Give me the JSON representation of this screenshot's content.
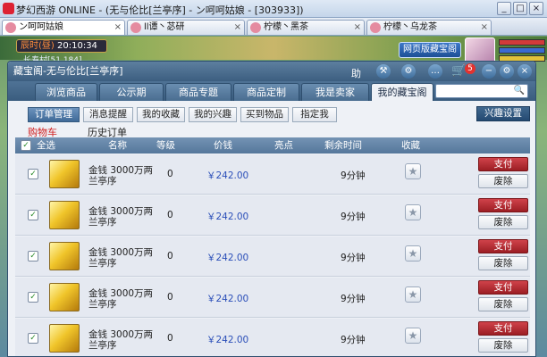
{
  "window": {
    "title": "梦幻西游 ONLINE - (无与伦比[兰亭序] - ン呵呵姑娘 - [303933])"
  },
  "browser_tabs": [
    {
      "label": "ン呵呵姑娘"
    },
    {
      "label": "ll谭丶苾研"
    },
    {
      "label": "柠檬丶黑茶"
    },
    {
      "label": "柠檬丶乌龙茶"
    }
  ],
  "game": {
    "time_label": "辰时(昼)",
    "time_value": "20:10:34",
    "location": "长寿村[51,184]",
    "web_button": "网页版藏宝阁"
  },
  "dialog": {
    "title": "藏宝阁-无与伦比[兰亭序]",
    "help_label": "助",
    "cart_count": "5",
    "nav_tabs": [
      {
        "label": "浏览商品"
      },
      {
        "label": "公示期"
      },
      {
        "label": "商品专题"
      },
      {
        "label": "商品定制"
      },
      {
        "label": "我是卖家"
      },
      {
        "label": "我的藏宝阁"
      }
    ],
    "sub_tabs": [
      {
        "label": "订单管理"
      },
      {
        "label": "消息提醒"
      },
      {
        "label": "我的收藏"
      },
      {
        "label": "我的兴趣"
      },
      {
        "label": "买到物品"
      },
      {
        "label": "指定我"
      }
    ],
    "settings_button": "兴趣设置",
    "cart_label": "购物车",
    "history_label": "历史订单",
    "table": {
      "headers": {
        "select_all": "全选",
        "name": "名称",
        "level": "等级",
        "price": "价钱",
        "highlight": "亮点",
        "remaining": "剩余时间",
        "favorite": "收藏"
      },
      "rows": [
        {
          "name": "金钱 3000万两 兰亭序",
          "level": "0",
          "price": "￥242.00",
          "remaining": "9分钟",
          "pay": "支付",
          "delete": "废除"
        },
        {
          "name": "金钱 3000万两 兰亭序",
          "level": "0",
          "price": "￥242.00",
          "remaining": "9分钟",
          "pay": "支付",
          "delete": "废除"
        },
        {
          "name": "金钱 3000万两 兰亭序",
          "level": "0",
          "price": "￥242.00",
          "remaining": "9分钟",
          "pay": "支付",
          "delete": "废除"
        },
        {
          "name": "金钱 3000万两 兰亭序",
          "level": "0",
          "price": "￥242.00",
          "remaining": "9分钟",
          "pay": "支付",
          "delete": "废除"
        },
        {
          "name": "金钱 3000万两 兰亭序",
          "level": "0",
          "price": "￥242.00",
          "remaining": "9分钟",
          "pay": "支付",
          "delete": "废除"
        }
      ]
    }
  }
}
